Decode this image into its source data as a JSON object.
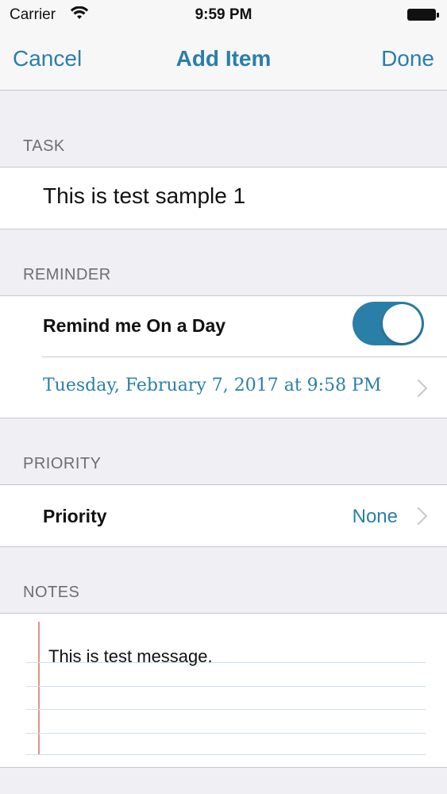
{
  "status_bar": {
    "carrier": "Carrier",
    "time": "9:59 PM"
  },
  "nav": {
    "cancel_label": "Cancel",
    "title": "Add Item",
    "done_label": "Done"
  },
  "task": {
    "header": "TASK",
    "value": "This is test sample 1"
  },
  "reminder": {
    "header": "REMINDER",
    "toggle_label": "Remind me On a Day",
    "toggle_on": true,
    "date_text": "Tuesday, February 7, 2017 at 9:58 PM"
  },
  "priority": {
    "header": "PRIORITY",
    "label": "Priority",
    "value": "None"
  },
  "notes": {
    "header": "NOTES",
    "text": "This is test message."
  },
  "colors": {
    "accent": "#2a7fa8",
    "background": "#efeff4",
    "margin_line": "#e5908a"
  }
}
